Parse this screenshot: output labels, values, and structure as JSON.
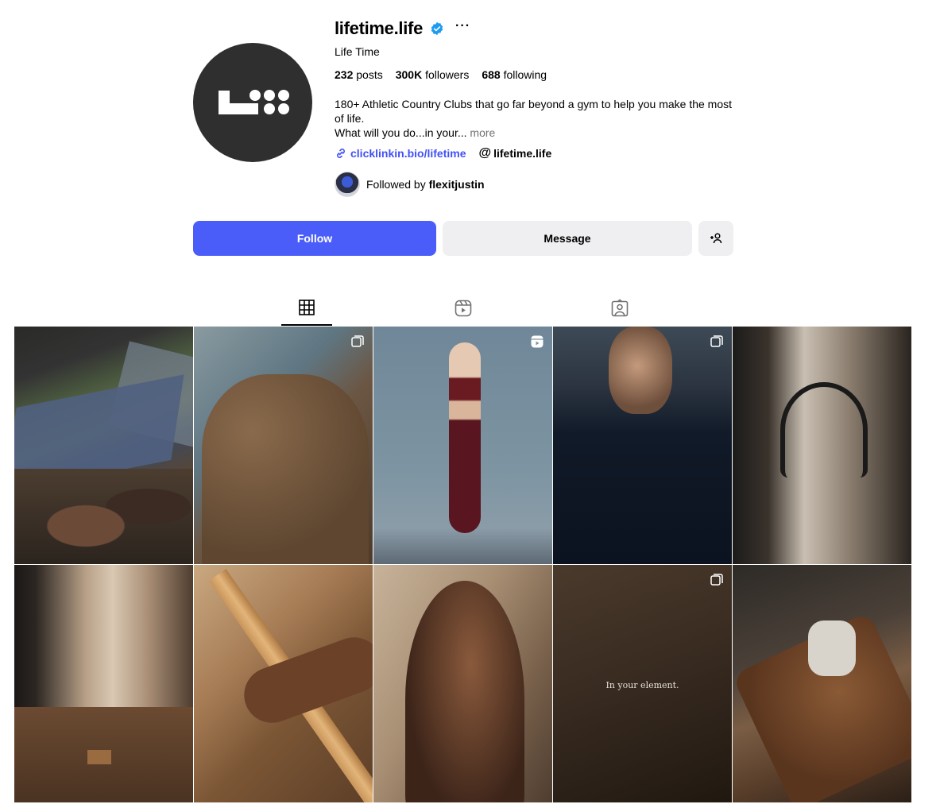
{
  "profile": {
    "username": "lifetime.life",
    "verified": true,
    "more_label": "···",
    "full_name": "Life Time",
    "stats": {
      "posts_count": "232",
      "posts_label": "posts",
      "followers_count": "300K",
      "followers_label": "followers",
      "following_count": "688",
      "following_label": "following"
    },
    "bio_line1": "180+ Athletic Country Clubs that go far beyond a gym to help you make the most of life.",
    "bio_line2": "What will you do...in your...",
    "bio_more": "more",
    "link_url": "clicklinkin.bio/lifetime",
    "threads_handle": "lifetime.life",
    "followed_by_label": "Followed by",
    "followed_by_user": "flexitjustin"
  },
  "actions": {
    "follow_label": "Follow",
    "message_label": "Message",
    "suggest_icon": "add-person-icon"
  },
  "tabs": [
    {
      "icon": "grid-icon",
      "active": true
    },
    {
      "icon": "reels-icon",
      "active": false
    },
    {
      "icon": "tagged-icon",
      "active": false
    }
  ],
  "posts": [
    {
      "id": 1,
      "badge": "none"
    },
    {
      "id": 2,
      "badge": "carousel"
    },
    {
      "id": 3,
      "badge": "reel"
    },
    {
      "id": 4,
      "badge": "carousel"
    },
    {
      "id": 5,
      "badge": "none"
    },
    {
      "id": 6,
      "badge": "none"
    },
    {
      "id": 7,
      "badge": "none"
    },
    {
      "id": 8,
      "badge": "none"
    },
    {
      "id": 9,
      "badge": "carousel",
      "caption": "In your element."
    },
    {
      "id": 10,
      "badge": "none"
    }
  ],
  "colors": {
    "primary_button": "#4a5df9",
    "link": "#4150f7",
    "secondary_button": "#efeff1",
    "verified": "#1d9bf0"
  }
}
